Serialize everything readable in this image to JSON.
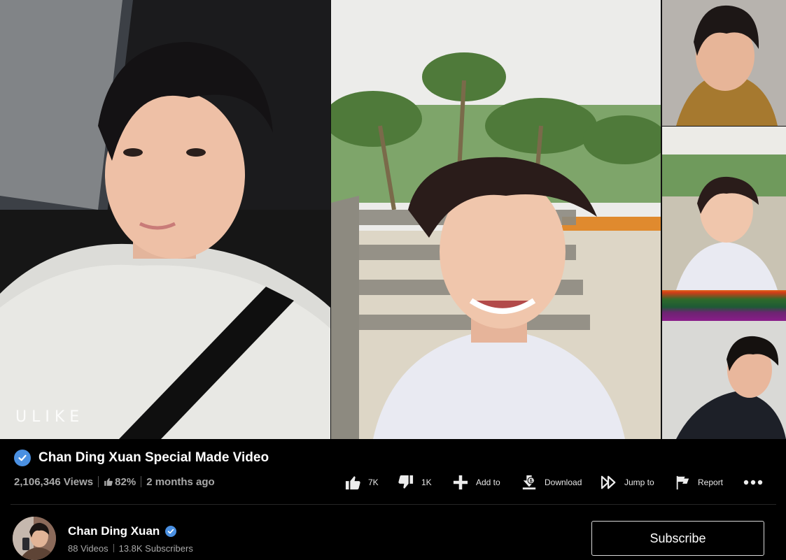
{
  "video": {
    "watermark": "ULIKE",
    "title": "Chan Ding Xuan Special Made Video",
    "verified_icon": "verified-check-icon",
    "views": "2,106,346 Views",
    "rating": "82%",
    "posted": "2 months ago"
  },
  "actions": [
    {
      "icon": "thumbs-up-icon",
      "label": "7K"
    },
    {
      "icon": "thumbs-down-icon",
      "label": "1K"
    },
    {
      "icon": "plus-icon",
      "label": "Add to"
    },
    {
      "icon": "download-icon",
      "label": "Download"
    },
    {
      "icon": "jump-forward-icon",
      "label": "Jump to"
    },
    {
      "icon": "flag-icon",
      "label": "Report"
    },
    {
      "icon": "more-dots-icon",
      "label": ""
    }
  ],
  "channel": {
    "name": "Chan Ding Xuan",
    "videos": "88 Videos",
    "subscribers": "13.8K Subscribers",
    "subscribe_label": "Subscribe"
  },
  "colors": {
    "background": "#000000",
    "verified": "#4a90e2",
    "muted_text": "#a9a9a9",
    "divider": "#262626"
  }
}
